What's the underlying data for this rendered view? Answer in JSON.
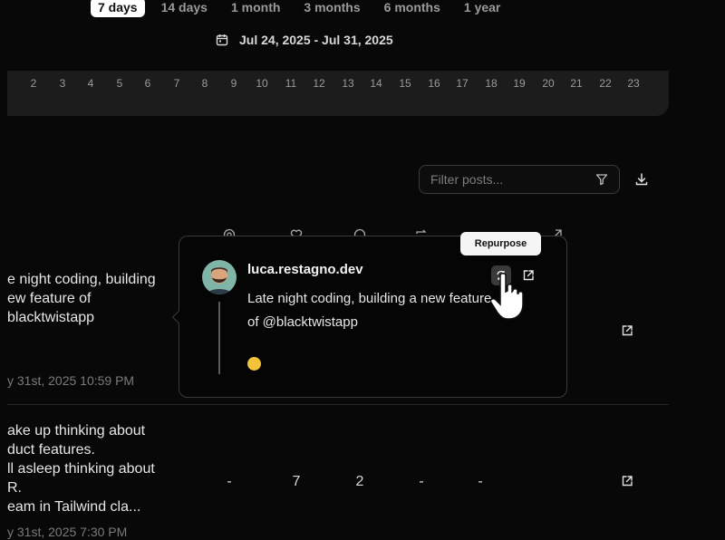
{
  "range_tabs": [
    {
      "label": "7 days",
      "active": true
    },
    {
      "label": "14 days",
      "active": false
    },
    {
      "label": "1 month",
      "active": false
    },
    {
      "label": "3 months",
      "active": false
    },
    {
      "label": "6 months",
      "active": false
    },
    {
      "label": "1 year",
      "active": false
    }
  ],
  "date_range": "Jul 24, 2025 - Jul 31, 2025",
  "hours": [
    "2",
    "3",
    "4",
    "5",
    "6",
    "7",
    "8",
    "9",
    "10",
    "11",
    "12",
    "13",
    "14",
    "15",
    "16",
    "17",
    "18",
    "19",
    "20",
    "21",
    "22",
    "23"
  ],
  "filter": {
    "placeholder": "Filter posts..."
  },
  "posts": [
    {
      "text_lines": [
        "e night coding, building",
        "ew feature of",
        "blacktwistapp"
      ],
      "timestamp": "y 31st, 2025 10:59 PM"
    },
    {
      "text_lines": [
        "ake up thinking about",
        "duct features.",
        "ll asleep thinking about",
        "R.",
        "eam in Tailwind cla..."
      ],
      "timestamp": "y 31st, 2025 7:30 PM",
      "metrics": [
        "-",
        "7",
        "2",
        "-",
        "-"
      ]
    }
  ],
  "popover": {
    "handle": "luca.restagno.dev",
    "body": "Late night coding, building a new feature of @blacktwistapp",
    "emoji": "thinking-face"
  },
  "tooltip": {
    "label": "Repurpose"
  },
  "colors": {
    "background": "#080808",
    "panel": "#1c1c1d",
    "border": "#3a3a3c",
    "tooltip_bg": "#f5f5f5"
  }
}
